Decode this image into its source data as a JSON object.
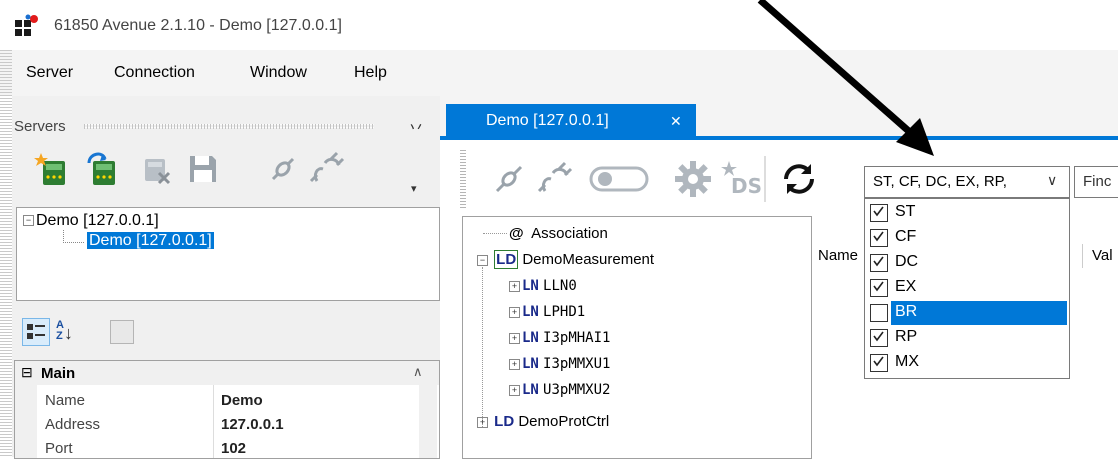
{
  "window": {
    "title": "61850 Avenue 2.1.10 - Demo [127.0.0.1]"
  },
  "menu": {
    "items": [
      "Server",
      "Connection",
      "Window",
      "Help"
    ]
  },
  "servers_panel": {
    "title": "Servers",
    "pin_glyph": "丷",
    "tree": {
      "parent": "Demo [127.0.0.1]",
      "child": "Demo [127.0.0.1]"
    },
    "toolbar_icons": [
      "new-server-icon",
      "connect-server-icon",
      "delete-server-icon",
      "save-icon",
      "disconnect-plug-icon",
      "connect-plug-icon"
    ]
  },
  "properties": {
    "category": "Main",
    "rows": [
      {
        "name": "Name",
        "value": "Demo"
      },
      {
        "name": "Address",
        "value": "127.0.0.1"
      },
      {
        "name": "Port",
        "value": "102"
      }
    ]
  },
  "document_tab": {
    "label": "Demo [127.0.0.1]",
    "close_glyph": "✕"
  },
  "filter_combo": {
    "value": "ST, CF, DC, EX, RP,",
    "chevron": "∨"
  },
  "find_box": {
    "placeholder": "Finc"
  },
  "dropdown": {
    "options": [
      {
        "label": "ST",
        "checked": true,
        "highlighted": false
      },
      {
        "label": "CF",
        "checked": true,
        "highlighted": false
      },
      {
        "label": "DC",
        "checked": true,
        "highlighted": false
      },
      {
        "label": "EX",
        "checked": true,
        "highlighted": false
      },
      {
        "label": "BR",
        "checked": false,
        "highlighted": true
      },
      {
        "label": "RP",
        "checked": true,
        "highlighted": false
      },
      {
        "label": "MX",
        "checked": true,
        "highlighted": false
      }
    ]
  },
  "model_tree": {
    "association": "Association",
    "association_prefix": "@",
    "ld_tag": "LD",
    "ln_tag": "LN",
    "ld1": "DemoMeasurement",
    "lns": [
      "LLN0",
      "LPHD1",
      "I3pMHAI1",
      "I3pMMXU1",
      "U3pMMXU2"
    ],
    "ld2": "DemoProtCtrl"
  },
  "list_header": {
    "col1": "Name",
    "col2": "Val"
  },
  "colors": {
    "accent": "#0078d7",
    "highlight": "#0078d7"
  }
}
